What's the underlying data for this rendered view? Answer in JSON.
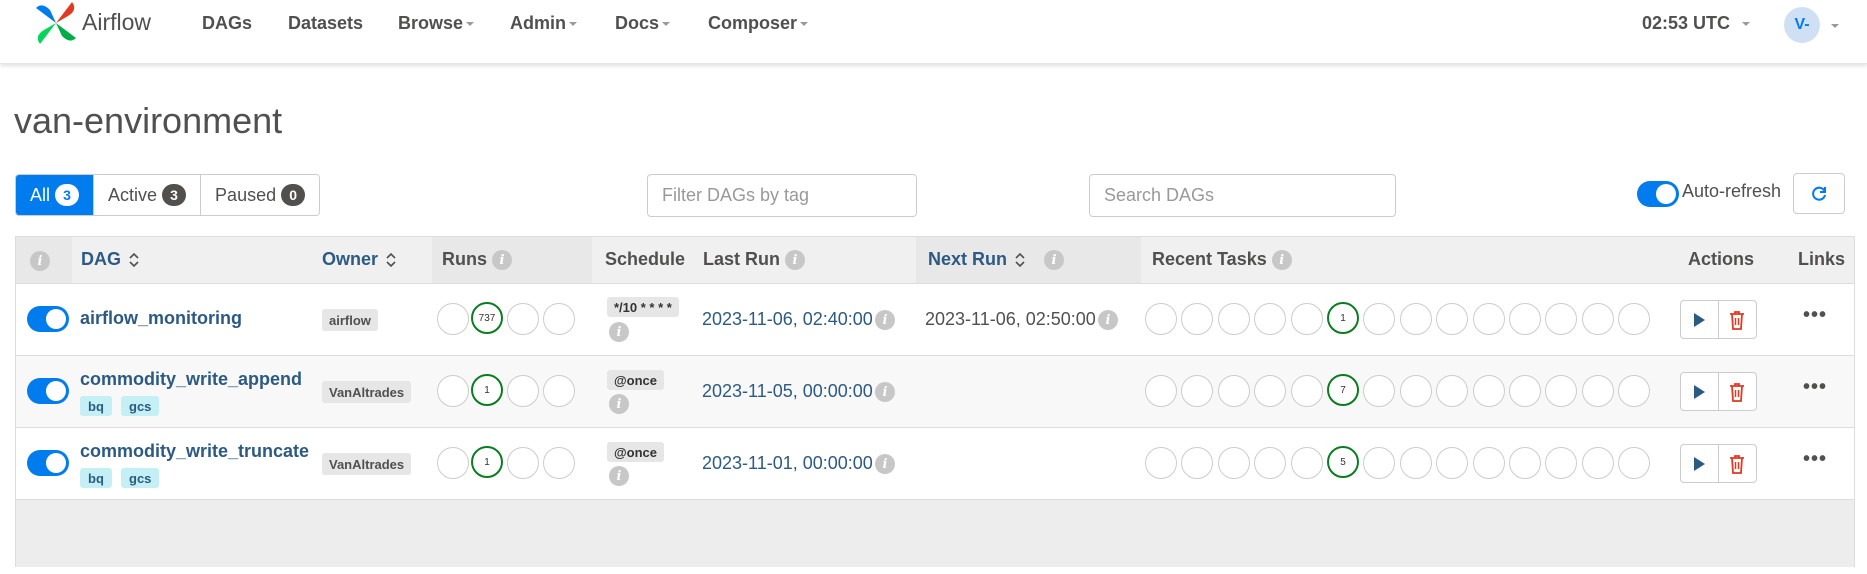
{
  "navbar": {
    "brand": "Airflow",
    "items": [
      {
        "label": "DAGs",
        "caret": false
      },
      {
        "label": "Datasets",
        "caret": false
      },
      {
        "label": "Browse",
        "caret": true
      },
      {
        "label": "Admin",
        "caret": true
      },
      {
        "label": "Docs",
        "caret": true
      },
      {
        "label": "Composer",
        "caret": true
      }
    ],
    "time": "02:53 UTC",
    "user_initials": "V-"
  },
  "page_title": "van-environment",
  "filters": {
    "all": {
      "label": "All",
      "count": "3"
    },
    "active": {
      "label": "Active",
      "count": "3"
    },
    "paused": {
      "label": "Paused",
      "count": "0"
    }
  },
  "tag_filter_placeholder": "Filter DAGs by tag",
  "search_placeholder": "Search DAGs",
  "auto_refresh_label": "Auto-refresh",
  "table": {
    "headers": {
      "dag": "DAG",
      "owner": "Owner",
      "runs": "Runs",
      "schedule": "Schedule",
      "last_run": "Last Run",
      "next_run": "Next Run",
      "recent_tasks": "Recent Tasks",
      "actions": "Actions",
      "links": "Links"
    },
    "rows": [
      {
        "dag_id": "airflow_monitoring",
        "tags": [],
        "owner": "airflow",
        "runs_count": "737",
        "schedule": "*/10 * * * *",
        "last_run": "2023-11-06, 02:40:00",
        "next_run": "2023-11-06, 02:50:00",
        "recent_tasks_count": "1"
      },
      {
        "dag_id": "commodity_write_append",
        "tags": [
          "bq",
          "gcs"
        ],
        "owner": "VanAltrades",
        "runs_count": "1",
        "schedule": "@once",
        "last_run": "2023-11-05, 00:00:00",
        "next_run": "",
        "recent_tasks_count": "7"
      },
      {
        "dag_id": "commodity_write_truncate",
        "tags": [
          "bq",
          "gcs"
        ],
        "owner": "VanAltrades",
        "runs_count": "1",
        "schedule": "@once",
        "last_run": "2023-11-01, 00:00:00",
        "next_run": "",
        "recent_tasks_count": "5"
      }
    ],
    "links_glyph": "•••",
    "info_glyph": "i"
  },
  "colors": {
    "accent": "#017cee",
    "dag_link": "#2c5a82",
    "success_green": "#0a7d1f",
    "delete_red": "#e43921",
    "tag_bg": "#c4eff4"
  },
  "icons": [
    "airflow-logo-icon",
    "info-icon",
    "sort-icon",
    "play-icon",
    "trash-icon",
    "refresh-icon",
    "more-icon"
  ]
}
